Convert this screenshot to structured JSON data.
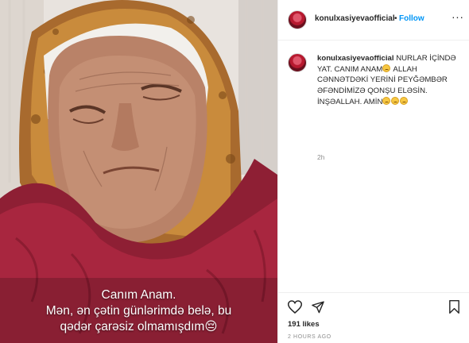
{
  "post": {
    "username": "konulxasiyevaofficial",
    "separator": "•",
    "follow_label": "Follow",
    "more_icon": "more-horizontal-icon",
    "more_glyph": "···"
  },
  "photo": {
    "caption_lines": [
      "Canım Anam.",
      "Mən, ən çətin günlərimdə belə, bu",
      "qədər çarəsiz olmamışdım😔"
    ]
  },
  "comment": {
    "username": "konulxasiyevaofficial",
    "text_part1": "NURLAR İÇİNDƏ YAT. CANIM ANAM",
    "text_part2": "ALLAH CƏNNƏTDƏKİ YERİNİ PEYĞƏMBƏR ƏFƏNDİMİZƏ QONŞU ELƏSİN. İNŞƏALLAH. AMİN",
    "emoji": "sad-face-emoji",
    "time": "2h"
  },
  "actions": {
    "like_icon": "heart-icon",
    "share_icon": "send-icon",
    "save_icon": "bookmark-icon",
    "likes": "191 likes",
    "posted": "2 HOURS AGO"
  },
  "colors": {
    "accent": "#0095f6",
    "text": "#262626",
    "muted": "#8e8e8e",
    "border": "#efefef"
  }
}
